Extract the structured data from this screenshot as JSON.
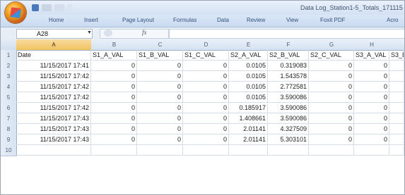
{
  "window": {
    "title": "Data Log_Station1-5_Totals_171115"
  },
  "ribbon": {
    "tabs": [
      "Home",
      "Insert",
      "Page Layout",
      "Formulas",
      "Data",
      "Review",
      "View",
      "Foxit PDF",
      "Acro"
    ]
  },
  "formula_bar": {
    "name_box": "A28",
    "fx_symbol": "fx",
    "formula": ""
  },
  "sheet": {
    "columns": [
      "A",
      "B",
      "C",
      "D",
      "E",
      "F",
      "G",
      "H",
      ""
    ],
    "selected_column": "A",
    "row_numbers": [
      "1",
      "2",
      "3",
      "4",
      "5",
      "6",
      "7",
      "8",
      "9",
      "10"
    ],
    "header_row": [
      "Date",
      "S1_A_VAL",
      "S1_B_VAL",
      "S1_C_VAL",
      "S2_A_VAL",
      "S2_B_VAL",
      "S2_C_VAL",
      "S3_A_VAL",
      "S3_B"
    ],
    "rows": [
      [
        "11/15/2017 17:41",
        "0",
        "0",
        "0",
        "0.0105",
        "0.319083",
        "0",
        "0",
        ""
      ],
      [
        "11/15/2017 17:42",
        "0",
        "0",
        "0",
        "0.0105",
        "1.543578",
        "0",
        "0",
        ""
      ],
      [
        "11/15/2017 17:42",
        "0",
        "0",
        "0",
        "0.0105",
        "2.772581",
        "0",
        "0",
        ""
      ],
      [
        "11/15/2017 17:42",
        "0",
        "0",
        "0",
        "0.0105",
        "3.590086",
        "0",
        "0",
        ""
      ],
      [
        "11/15/2017 17:42",
        "0",
        "0",
        "0",
        "0.185917",
        "3.590086",
        "0",
        "0",
        ""
      ],
      [
        "11/15/2017 17:43",
        "0",
        "0",
        "0",
        "1.408661",
        "3.590086",
        "0",
        "0",
        ""
      ],
      [
        "11/15/2017 17:43",
        "0",
        "0",
        "0",
        "2.01141",
        "4.327509",
        "0",
        "0",
        ""
      ],
      [
        "11/15/2017 17:43",
        "0",
        "0",
        "0",
        "2.01141",
        "5.303101",
        "0",
        "0",
        ""
      ],
      [
        "",
        "",
        "",
        "",
        "",
        "",
        "",
        "",
        ""
      ]
    ]
  },
  "icons": {
    "office_button": "office-logo-icon",
    "save": "save-icon",
    "undo": "undo-icon",
    "redo": "redo-icon"
  },
  "colors": {
    "ribbon": "#c9daf0",
    "selected_column": "#f1c15f",
    "gridline": "#d6dde6"
  }
}
